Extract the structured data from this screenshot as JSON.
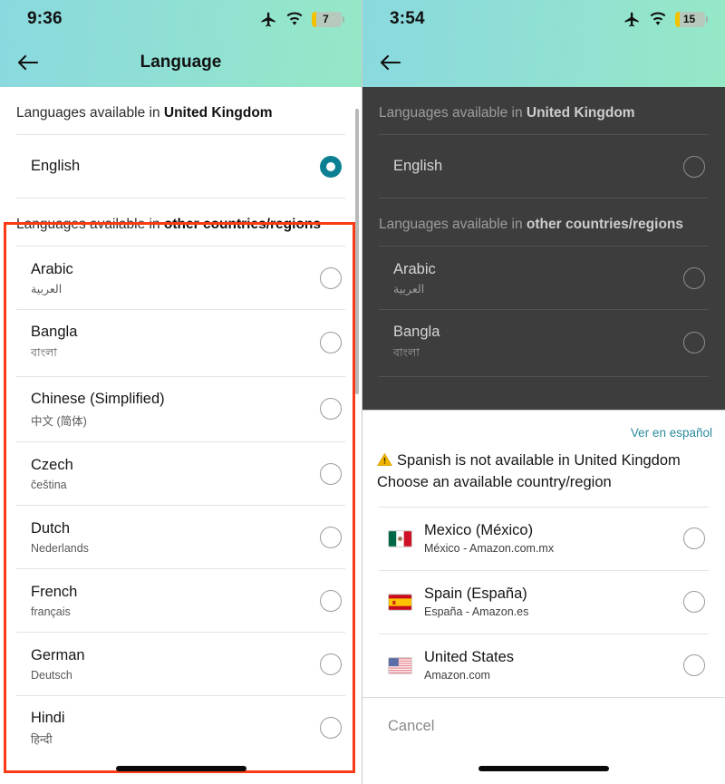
{
  "left": {
    "status": {
      "time": "9:36",
      "battery_level": "7",
      "icons": [
        "airplane-mode-icon",
        "wifi-icon",
        "battery-icon"
      ]
    },
    "nav": {
      "title": "Language",
      "back_label": "Back"
    },
    "sections": [
      {
        "prefix": "Languages available in ",
        "strong": "United Kingdom",
        "items": [
          {
            "name": "English",
            "native": "",
            "selected": true
          }
        ]
      },
      {
        "prefix": "Languages available in ",
        "strong": "other countries/regions",
        "items": [
          {
            "name": "Arabic",
            "native": "العربية",
            "selected": false
          },
          {
            "name": "Bangla",
            "native": "বাংলা",
            "selected": false
          },
          {
            "name": "Chinese (Simplified)",
            "native": "中文 (简体)",
            "selected": false
          },
          {
            "name": "Czech",
            "native": "čeština",
            "selected": false
          },
          {
            "name": "Dutch",
            "native": "Nederlands",
            "selected": false
          },
          {
            "name": "French",
            "native": "français",
            "selected": false
          },
          {
            "name": "German",
            "native": "Deutsch",
            "selected": false
          },
          {
            "name": "Hindi",
            "native": "हिन्दी",
            "selected": false
          }
        ]
      }
    ],
    "annotation": {
      "color": "#fb3a16",
      "shape": "rectangle-highlight"
    }
  },
  "right": {
    "status": {
      "time": "3:54",
      "battery_level": "15",
      "icons": [
        "airplane-mode-icon",
        "wifi-icon",
        "battery-icon"
      ]
    },
    "nav": {
      "title": "",
      "back_label": "Back"
    },
    "sections": [
      {
        "prefix": "Languages available in ",
        "strong": "United Kingdom",
        "items": [
          {
            "name": "English",
            "native": "",
            "selected": false
          }
        ]
      },
      {
        "prefix": "Languages available in ",
        "strong": "other countries/regions",
        "items": [
          {
            "name": "Arabic",
            "native": "العربية",
            "selected": false
          },
          {
            "name": "Bangla",
            "native": "বাংলা",
            "selected": false
          }
        ]
      }
    ],
    "sheet": {
      "link": "Ver en español",
      "message_line1": "Spanish is not available in United Kingdom",
      "message_line2": "Choose an available country/region",
      "warning_color": "#f0b400",
      "countries": [
        {
          "name": "Mexico (México)",
          "sub": "México - Amazon.com.mx",
          "flag": "mexico-flag",
          "selected": false
        },
        {
          "name": "Spain (España)",
          "sub": "España - Amazon.es",
          "flag": "spain-flag",
          "selected": false
        },
        {
          "name": "United States",
          "sub": "Amazon.com",
          "flag": "united-states-flag",
          "selected": false
        }
      ],
      "cancel": "Cancel"
    }
  },
  "theme": {
    "accent_teal": "#0d7f93",
    "link_teal": "#2b8a9e",
    "header_gradient_from": "#8ad9df",
    "header_gradient_to": "#95e8c6",
    "overlay_dim": "#3d3d3d",
    "annotation_red": "#fb3a16"
  }
}
